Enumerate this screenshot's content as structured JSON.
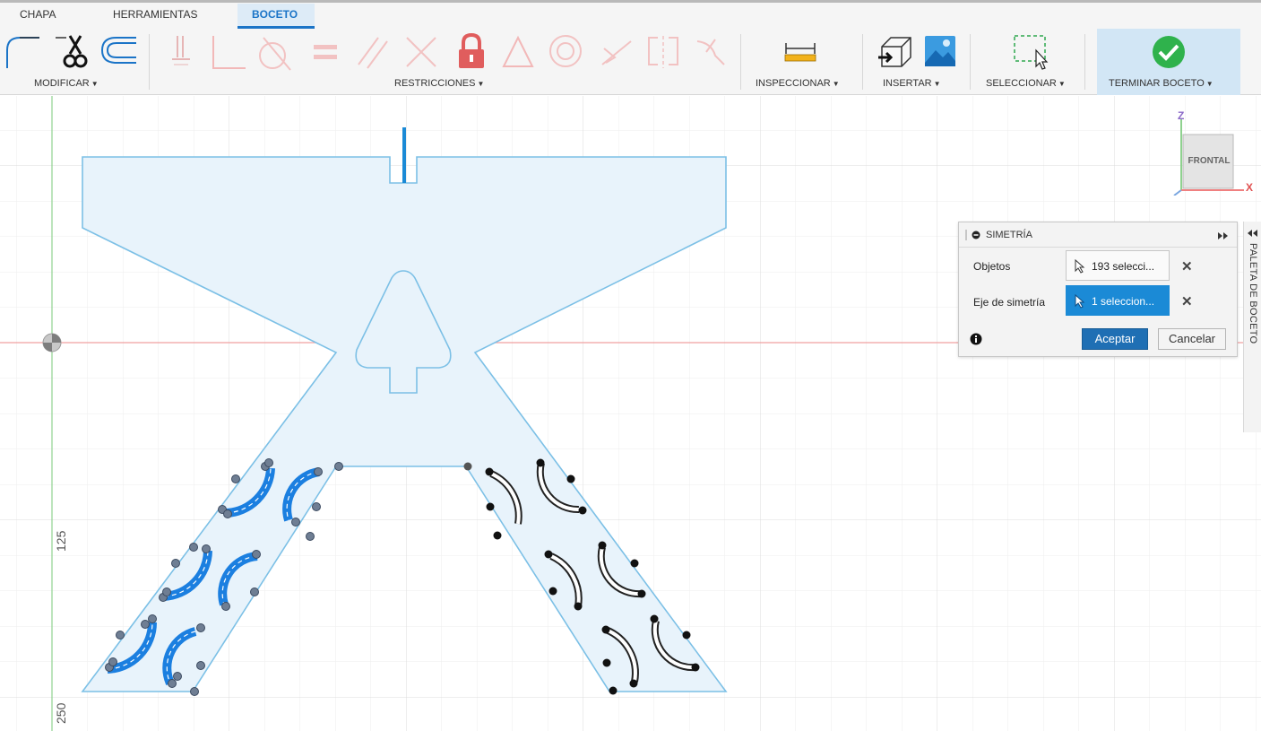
{
  "tabs": [
    {
      "label": "CHAPA"
    },
    {
      "label": "HERRAMIENTAS"
    },
    {
      "label": "BOCETO",
      "active": true
    }
  ],
  "groups": {
    "modify": "MODIFICAR",
    "constraints": "RESTRICCIONES",
    "inspect": "INSPECCIONAR",
    "insert": "INSERTAR",
    "select": "SELECCIONAR",
    "finish": "TERMINAR BOCETO"
  },
  "tools": {
    "modify": [
      "fillet-icon",
      "trim-icon",
      "offset-icon"
    ],
    "constraints": [
      "coincident-icon",
      "perpendicular-icon",
      "tangent-icon",
      "equal-icon",
      "parallel-icon",
      "collinear-icon",
      "fix-icon",
      "triangle-icon",
      "concentric-icon",
      "midpoint-icon",
      "symmetry-icon",
      "curvature-icon"
    ],
    "inspect": [
      "measure-icon"
    ],
    "insert": [
      "insert-derive-icon",
      "insert-image-icon"
    ],
    "select": [
      "window-select-icon"
    ],
    "finish": [
      "checkmark-icon"
    ]
  },
  "axis_labels": {
    "y_125": "125",
    "y_250": "250"
  },
  "viewcube": {
    "face": "FRONTAL",
    "axis_z": "Z",
    "axis_x": "X"
  },
  "dialog": {
    "title": "SIMETRÍA",
    "rows": [
      {
        "label": "Objetos",
        "value": "193 selecci...",
        "active": false
      },
      {
        "label": "Eje de simetría",
        "value": "1 seleccion...",
        "active": true
      }
    ],
    "ok": "Aceptar",
    "cancel": "Cancelar"
  },
  "palette": {
    "label": "PALETA DE BOCETO"
  },
  "colors": {
    "accent": "#1b74c7",
    "selection_blue": "#1b8ad6",
    "profile_fill": "#e8f3fb",
    "profile_stroke": "#7cc0e6",
    "x_axis": "#f0a0a0",
    "y_axis": "#8fd18f",
    "finish_check": "#2fb24c"
  }
}
